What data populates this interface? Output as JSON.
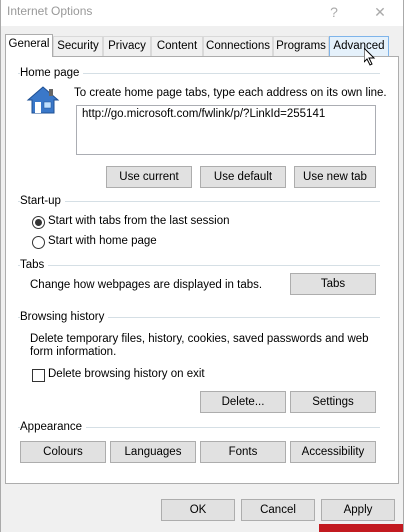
{
  "window": {
    "title": "Internet Options",
    "help_label": "?",
    "close_label": "✕"
  },
  "tabs": [
    {
      "label": "General",
      "active": true
    },
    {
      "label": "Security"
    },
    {
      "label": "Privacy"
    },
    {
      "label": "Content"
    },
    {
      "label": "Connections"
    },
    {
      "label": "Programs"
    },
    {
      "label": "Advanced"
    }
  ],
  "home_page": {
    "heading": "Home page",
    "description": "To create home page tabs, type each address on its own line.",
    "url": "http://go.microsoft.com/fwlink/p/?LinkId=255141",
    "use_current_label": "Use current",
    "use_default_label": "Use default",
    "use_new_tab_label": "Use new tab"
  },
  "startup": {
    "heading": "Start-up",
    "option_last_session": "Start with tabs from the last session",
    "option_home_page": "Start with home page",
    "selected": "last_session"
  },
  "tabs_section": {
    "heading": "Tabs",
    "description": "Change how webpages are displayed in tabs.",
    "button_label": "Tabs"
  },
  "browsing_history": {
    "heading": "Browsing history",
    "description_line1": "Delete temporary files, history, cookies, saved passwords and web",
    "description_line2": "form information.",
    "delete_on_exit_label": "Delete browsing history on exit",
    "delete_on_exit_checked": false,
    "delete_label": "Delete...",
    "settings_label": "Settings"
  },
  "appearance": {
    "heading": "Appearance",
    "colours_label": "Colours",
    "languages_label": "Languages",
    "fonts_label": "Fonts",
    "accessibility_label": "Accessibility"
  },
  "footer": {
    "ok_label": "OK",
    "cancel_label": "Cancel",
    "apply_label": "Apply"
  }
}
